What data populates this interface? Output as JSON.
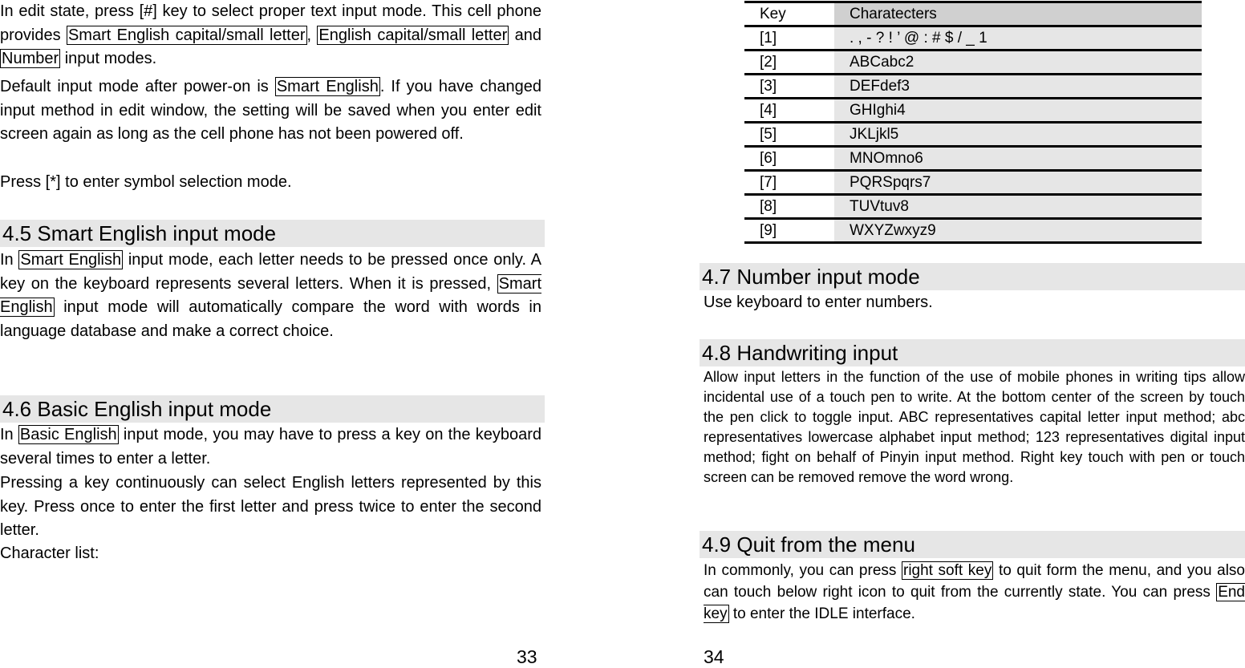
{
  "left": {
    "para1": [
      {
        "t": "In edit state, press [#] key to select proper text input mode. This cell phone provides "
      },
      {
        "t": "Smart English capital/small letter",
        "box": true
      },
      {
        "t": ", "
      },
      {
        "t": "English capital/small letter",
        "box": true
      },
      {
        "t": " and "
      },
      {
        "t": "Number",
        "box": true
      },
      {
        "t": " input modes."
      }
    ],
    "para2": [
      {
        "t": "Default input mode after power-on is "
      },
      {
        "t": "Smart English",
        "box": true
      },
      {
        "t": ". If you have changed input method in edit window, the setting will be saved when you enter edit screen again as long as the cell phone has not been powered off."
      }
    ],
    "para3": [
      {
        "t": "Press [*] to enter symbol selection mode."
      }
    ],
    "h45": "4.5 Smart English input mode",
    "para4": [
      {
        "t": "In "
      },
      {
        "t": "Smart English",
        "box": true
      },
      {
        "t": " input mode, each letter needs to be pressed once only. A key on the keyboard represents several letters. When it is pressed, "
      },
      {
        "t": "Smart English",
        "box": true
      },
      {
        "t": " input mode will automatically compare the word with words in language database and make a correct choice."
      }
    ],
    "h46": "4.6 Basic English input mode",
    "para5": [
      {
        "t": "In "
      },
      {
        "t": "Basic English",
        "box": true
      },
      {
        "t": " input mode, you may have to press a key on the keyboard several times to enter a letter."
      }
    ],
    "para6": [
      {
        "t": "Pressing a key continuously can select English letters represented by this key. Press once to enter the first letter and press twice to enter the second letter."
      }
    ],
    "para7": [
      {
        "t": "Character list:"
      }
    ],
    "page": "33"
  },
  "right": {
    "table": {
      "headers": [
        "Key",
        "Charatecters"
      ],
      "rows": [
        [
          "[1]",
          ". , - ? ! ’ @ : # $ / _ 1"
        ],
        [
          "[2]",
          "ABCabc2"
        ],
        [
          "[3]",
          "DEFdef3"
        ],
        [
          "[4]",
          "GHIghi4"
        ],
        [
          "[5]",
          "JKLjkl5"
        ],
        [
          "[6]",
          "MNOmno6"
        ],
        [
          "[7]",
          "PQRSpqrs7"
        ],
        [
          "[8]",
          "TUVtuv8"
        ],
        [
          "[9]",
          "WXYZwxyz9"
        ]
      ]
    },
    "h47": "4.7 Number input mode",
    "para1": [
      {
        "t": "Use keyboard to enter numbers."
      }
    ],
    "h48": "4.8 Handwriting input",
    "para2": [
      {
        "t": "Allow input letters in the function of the use of mobile phones in writing tips allow incidental use of a touch pen to write. At the bottom center of the screen by touch the pen click to toggle input. ABC representatives capital letter input method; abc representatives lowercase alphabet input method; 123 representatives digital input method; fight on behalf of Pinyin input method. Right key touch with pen or touch screen can be removed remove the word wrong."
      }
    ],
    "h49": "4.9 Quit from the menu",
    "para3": [
      {
        "t": "In commonly, you can press "
      },
      {
        "t": "right soft key",
        "box": true
      },
      {
        "t": " to quit form the menu, and you also can touch below right icon to quit from the currently state. You can press "
      },
      {
        "t": "End key",
        "box": true
      },
      {
        "t": " to enter the IDLE interface."
      }
    ],
    "page": "34"
  }
}
